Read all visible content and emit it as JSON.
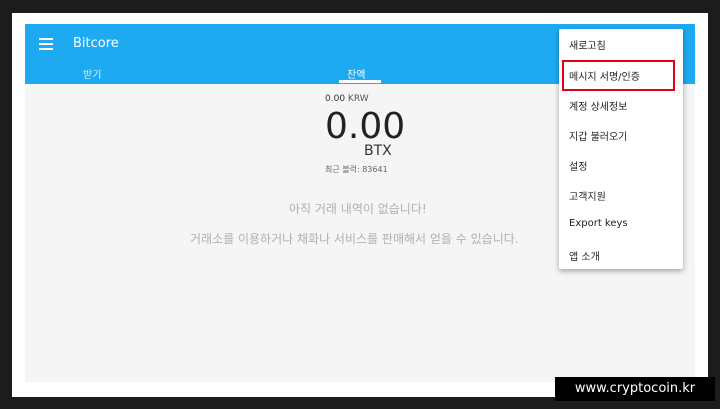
{
  "app": {
    "title": "Bitcore"
  },
  "tabs": [
    {
      "label": "받기"
    },
    {
      "label": "잔액"
    }
  ],
  "balance": {
    "alt_amount": "0.00",
    "alt_unit": "KRW",
    "amount": "0.00",
    "unit": "BTX",
    "last_block": "최근 블럭: 83641"
  },
  "empty_state": {
    "title": "아직 거래 내역이 없습니다!",
    "subtitle": "거래소를 이용하거나 채화나 서비스를 판매해서 얻을 수 있습니다."
  },
  "menu": {
    "items": [
      {
        "label": "새로고침"
      },
      {
        "label": "메시지 서명/인증"
      },
      {
        "label": "계정 상세정보"
      },
      {
        "label": "지갑 불러오기"
      },
      {
        "label": "설정"
      },
      {
        "label": "고객지원"
      },
      {
        "label": "Export keys"
      },
      {
        "label": "앱 소개"
      }
    ]
  },
  "watermark": "www.cryptocoin.kr",
  "colors": {
    "appbar": "#1eaaf1",
    "highlight": "#e3001b",
    "background": "#f5f5f5"
  }
}
